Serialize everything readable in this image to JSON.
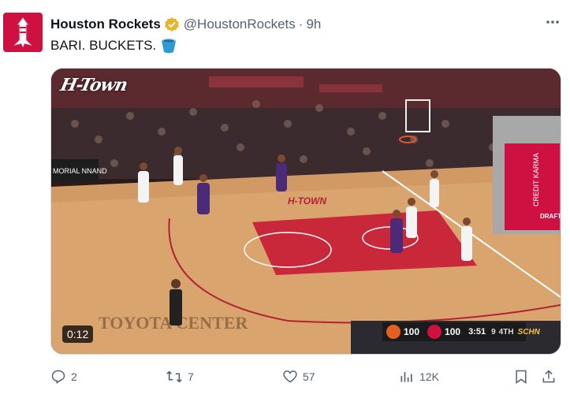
{
  "author": {
    "name": "Houston Rockets",
    "handle": "@HoustonRockets",
    "separator": "·",
    "time": "9h",
    "avatar_icon": "rockets-logo-icon",
    "verified_color": "#e8b22a"
  },
  "tweet": {
    "text": "BARI. BUCKETS.",
    "emoji_icon": "bucket-icon"
  },
  "media": {
    "watermark": "H-Town",
    "duration": "0:12",
    "scorebug": {
      "away_score": "100",
      "home_score": "100",
      "clock": "3:51",
      "shot_clock": "9",
      "period": "4TH",
      "network": "SCHN"
    },
    "arena_text": {
      "baseline": "TOYOTA CENTER",
      "sideline": "CREDIT KARMA",
      "corner": "DRAFT KINGS",
      "court": "H-TOWN",
      "left_sign": "MORIAL NNAND"
    },
    "accent": "#ce1141"
  },
  "actions": {
    "replies": "2",
    "reposts": "7",
    "likes": "57",
    "views": "12K"
  },
  "colors": {
    "muted": "#536471",
    "brand": "#ce1141"
  }
}
